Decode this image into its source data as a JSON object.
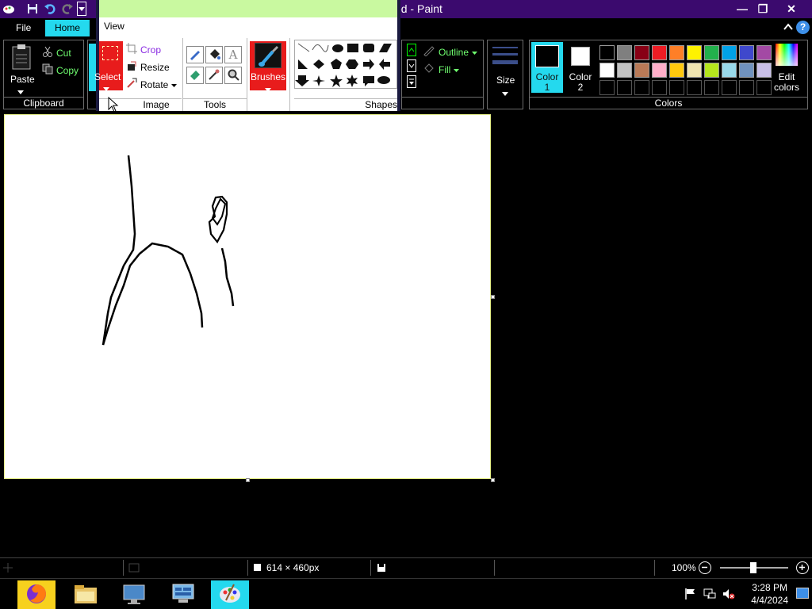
{
  "window": {
    "title": "Untitled - Paint",
    "minimize": "—",
    "maximize": "❐",
    "close": "✕"
  },
  "tabs": {
    "file": "File",
    "home": "Home",
    "view": "View"
  },
  "clipboard": {
    "paste": "Paste",
    "cut": "Cut",
    "copy": "Copy",
    "label": "Clipboard"
  },
  "image": {
    "select": "Select",
    "crop": "Crop",
    "resize": "Resize",
    "rotate": "Rotate",
    "label": "Image"
  },
  "tools": {
    "label": "Tools"
  },
  "brushes": {
    "label": "Brushes"
  },
  "shapes": {
    "outline": "Outline",
    "fill": "Fill",
    "label": "Shapes"
  },
  "size": {
    "label": "Size"
  },
  "colors": {
    "color1": "Color\n1",
    "color1_top": "Color",
    "color1_bottom": "1",
    "color2_top": "Color",
    "color2_bottom": "2",
    "edit_top": "Edit",
    "edit_bottom": "colors",
    "label": "Colors",
    "palette_row1": [
      "#000000",
      "#7f7f7f",
      "#880015",
      "#ed1c24",
      "#ff7f27",
      "#fff200",
      "#22b14c",
      "#00a2e8",
      "#3f48cc",
      "#a349a4"
    ],
    "palette_row2": [
      "#ffffff",
      "#c3c3c3",
      "#b97a57",
      "#ffaec9",
      "#ffc90e",
      "#efe4b0",
      "#b5e61d",
      "#99d9ea",
      "#7092be",
      "#c8bfe7"
    ],
    "primary": "#000000",
    "secondary": "#ffffff"
  },
  "status": {
    "dimensions": "614 × 460px",
    "zoom": "100%"
  },
  "taskbar": {
    "time": "3:28 PM",
    "date": "4/4/2024"
  }
}
